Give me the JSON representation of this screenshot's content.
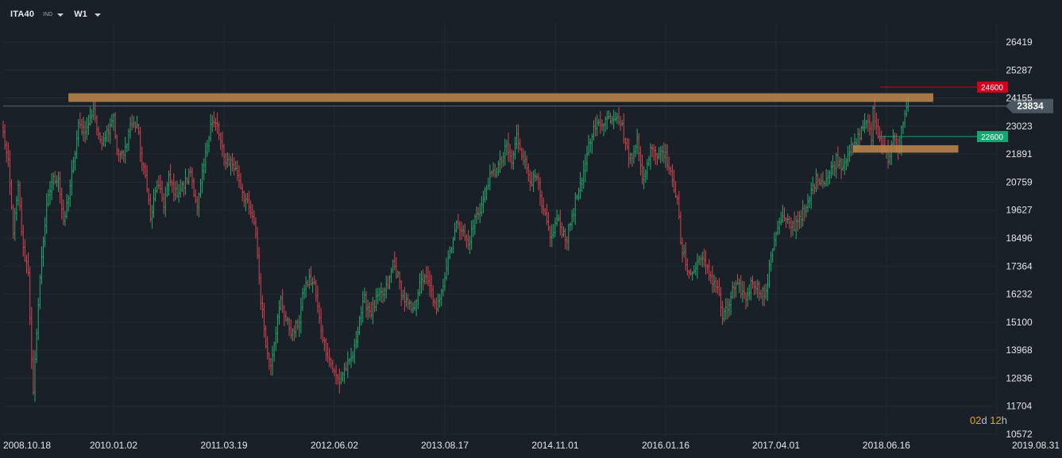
{
  "toolbar": {
    "symbol": "ITA40",
    "symbol_type": "IND",
    "timeframe": "W1"
  },
  "countdown": {
    "days": "02",
    "days_unit": "d",
    "hours": "12",
    "hours_unit": "h"
  },
  "colors": {
    "background": "#1a2027",
    "grid": "#232b33",
    "axis_text": "#e3e6ea",
    "bull": "#26a96c",
    "bear": "#d64550",
    "zone": "#b8844a",
    "resistance_badge": "#d0021b",
    "support_badge": "#11a873",
    "price_badge": "#4b5661",
    "price_line": "#5c6a78"
  },
  "chart_data": {
    "type": "bar",
    "subtype": "ohlc",
    "title": "",
    "ylim": [
      10572,
      27551
    ],
    "y_ticks": [
      26419,
      25287,
      24155,
      23023,
      21891,
      20759,
      19627,
      18496,
      17364,
      16232,
      15100,
      13968,
      12836,
      11704,
      10572
    ],
    "x_ticks": [
      "2008.10.18",
      "2010.01.02",
      "2011.03.19",
      "2012.06.02",
      "2013.08.17",
      "2014.11.01",
      "2016.01.16",
      "2017.04.01",
      "2018.06.16",
      "2019.08.31"
    ],
    "x_range": [
      "2008.10.18",
      "2019.08.31"
    ],
    "grid": true,
    "bars_per_tick": 66,
    "trajectory": [
      [
        0,
        22700
      ],
      [
        3,
        21500
      ],
      [
        6,
        18800
      ],
      [
        9,
        20500
      ],
      [
        12,
        18000
      ],
      [
        15,
        17200
      ],
      [
        17,
        13500
      ],
      [
        18,
        12100
      ],
      [
        20,
        14800
      ],
      [
        23,
        17800
      ],
      [
        26,
        19700
      ],
      [
        29,
        20800
      ],
      [
        33,
        21000
      ],
      [
        36,
        19000
      ],
      [
        39,
        20200
      ],
      [
        42,
        21500
      ],
      [
        45,
        23000
      ],
      [
        50,
        22900
      ],
      [
        54,
        23800
      ],
      [
        57,
        22500
      ],
      [
        59,
        22500
      ],
      [
        62,
        22800
      ],
      [
        66,
        23500
      ],
      [
        68,
        21900
      ],
      [
        72,
        21800
      ],
      [
        76,
        23100
      ],
      [
        80,
        23100
      ],
      [
        83,
        21500
      ],
      [
        86,
        20700
      ],
      [
        88,
        19200
      ],
      [
        92,
        20700
      ],
      [
        96,
        19900
      ],
      [
        99,
        20900
      ],
      [
        103,
        20300
      ],
      [
        108,
        20600
      ],
      [
        112,
        21200
      ],
      [
        116,
        19700
      ],
      [
        120,
        21400
      ],
      [
        124,
        23200
      ],
      [
        128,
        23000
      ],
      [
        132,
        21700
      ],
      [
        136,
        21600
      ],
      [
        140,
        21100
      ],
      [
        144,
        20200
      ],
      [
        148,
        19500
      ],
      [
        151,
        18700
      ],
      [
        154,
        16000
      ],
      [
        158,
        13800
      ],
      [
        160,
        13500
      ],
      [
        163,
        14800
      ],
      [
        166,
        16000
      ],
      [
        169,
        15200
      ],
      [
        173,
        14600
      ],
      [
        177,
        15200
      ],
      [
        180,
        16500
      ],
      [
        183,
        16800
      ],
      [
        186,
        16600
      ],
      [
        189,
        15200
      ],
      [
        192,
        14200
      ],
      [
        195,
        13600
      ],
      [
        198,
        13000
      ],
      [
        201,
        12700
      ],
      [
        204,
        13200
      ],
      [
        207,
        13400
      ],
      [
        210,
        14000
      ],
      [
        213,
        15300
      ],
      [
        216,
        16000
      ],
      [
        220,
        15500
      ],
      [
        224,
        16100
      ],
      [
        228,
        16300
      ],
      [
        231,
        16800
      ],
      [
        233,
        17500
      ],
      [
        236,
        16900
      ],
      [
        239,
        16100
      ],
      [
        242,
        15800
      ],
      [
        245,
        15500
      ],
      [
        248,
        16400
      ],
      [
        252,
        17000
      ],
      [
        256,
        16300
      ],
      [
        259,
        15500
      ],
      [
        262,
        16500
      ],
      [
        264,
        17000
      ],
      [
        266,
        17700
      ],
      [
        269,
        18500
      ],
      [
        272,
        19200
      ],
      [
        275,
        18700
      ],
      [
        278,
        18200
      ],
      [
        282,
        19300
      ],
      [
        286,
        19800
      ],
      [
        290,
        20800
      ],
      [
        294,
        21200
      ],
      [
        298,
        21600
      ],
      [
        301,
        22200
      ],
      [
        304,
        21500
      ],
      [
        307,
        22600
      ],
      [
        310,
        22000
      ],
      [
        313,
        21300
      ],
      [
        316,
        20800
      ],
      [
        319,
        20900
      ],
      [
        322,
        19700
      ],
      [
        325,
        19100
      ],
      [
        328,
        18500
      ],
      [
        331,
        19300
      ],
      [
        334,
        18800
      ],
      [
        337,
        18500
      ],
      [
        340,
        19400
      ],
      [
        343,
        20200
      ],
      [
        346,
        20700
      ],
      [
        349,
        22000
      ],
      [
        352,
        22800
      ],
      [
        356,
        23100
      ],
      [
        360,
        23300
      ],
      [
        364,
        23400
      ],
      [
        367,
        23500
      ],
      [
        370,
        23000
      ],
      [
        373,
        22000
      ],
      [
        376,
        21700
      ],
      [
        379,
        22700
      ],
      [
        382,
        20700
      ],
      [
        385,
        21500
      ],
      [
        388,
        22300
      ],
      [
        391,
        21800
      ],
      [
        394,
        22200
      ],
      [
        397,
        21600
      ],
      [
        400,
        20700
      ],
      [
        403,
        20200
      ],
      [
        405,
        18200
      ],
      [
        408,
        17500
      ],
      [
        411,
        17000
      ],
      [
        414,
        17300
      ],
      [
        417,
        17800
      ],
      [
        420,
        17300
      ],
      [
        424,
        16800
      ],
      [
        427,
        16500
      ],
      [
        430,
        15300
      ],
      [
        433,
        15600
      ],
      [
        436,
        16400
      ],
      [
        440,
        16500
      ],
      [
        444,
        16100
      ],
      [
        448,
        16800
      ],
      [
        452,
        16400
      ],
      [
        456,
        16200
      ],
      [
        459,
        17800
      ],
      [
        462,
        18800
      ],
      [
        466,
        19300
      ],
      [
        470,
        19000
      ],
      [
        473,
        19000
      ],
      [
        476,
        19400
      ],
      [
        480,
        19600
      ],
      [
        484,
        20600
      ],
      [
        487,
        21000
      ],
      [
        490,
        20800
      ],
      [
        494,
        21100
      ],
      [
        498,
        21700
      ],
      [
        502,
        21400
      ],
      [
        505,
        22000
      ],
      [
        509,
        22200
      ],
      [
        512,
        22700
      ],
      [
        516,
        23300
      ],
      [
        519,
        22500
      ],
      [
        520,
        23700
      ],
      [
        523,
        22600
      ],
      [
        526,
        22300
      ],
      [
        529,
        21700
      ],
      [
        532,
        22500
      ],
      [
        535,
        21900
      ],
      [
        538,
        23300
      ],
      [
        541,
        23800
      ]
    ],
    "horizontal_levels": [
      {
        "label": "24600",
        "value": 24600,
        "role": "resistance"
      },
      {
        "label": "22600",
        "value": 22600,
        "role": "support"
      }
    ],
    "zones": [
      {
        "name": "resistance-zone",
        "low": 24000,
        "high": 24350,
        "from_bar": 39,
        "to_bar": 556
      },
      {
        "name": "support-zone",
        "low": 21950,
        "high": 22250,
        "from_bar": 508,
        "to_bar": 571
      }
    ],
    "current_price": {
      "label": "23834",
      "value": 23834
    },
    "bars_total": 541
  }
}
